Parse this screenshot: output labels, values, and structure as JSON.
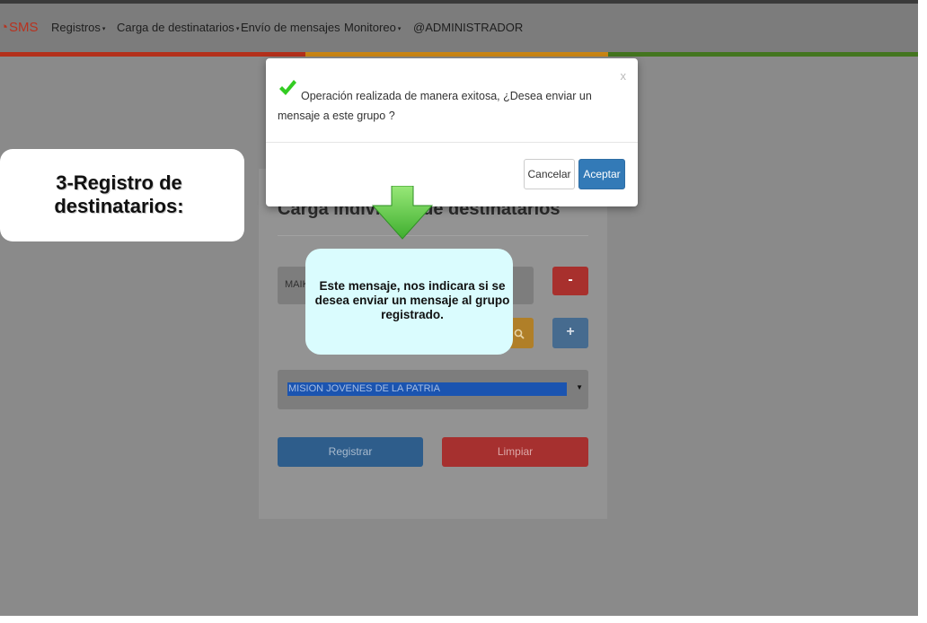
{
  "navbar": {
    "brand": "SMS",
    "items": [
      {
        "label": "Registros",
        "has_caret": true
      },
      {
        "label": "Carga de destinatarios",
        "has_caret": true
      },
      {
        "label": "Envío de mensajes",
        "has_caret": false
      },
      {
        "label": "Monitoreo",
        "has_caret": true
      },
      {
        "label": "@ADMINISTRADOR",
        "has_caret": false
      }
    ],
    "caret_glyph": "▾",
    "brand_icon": "sms-logo-icon"
  },
  "colors": {
    "bar_red": "#b3301b",
    "bar_orange": "#c98514",
    "bar_green": "#43751f",
    "accept_blue": "#337ab7",
    "check_green": "#33cc22",
    "callout_cyan": "#dafcfe"
  },
  "form": {
    "title": "Carga individual de destinatarios",
    "name_value": "MAIK",
    "minus_label": "-",
    "plus_label": "+",
    "search_icon": "search-icon",
    "group_selected": "MISION JOVENES DE LA PATRIA",
    "register_label": "Registrar",
    "clear_label": "Limpiar"
  },
  "modal": {
    "close_label": "x",
    "message": "Operación realizada de manera exitosa, ¿Desea enviar un mensaje a este grupo ?",
    "cancel_label": "Cancelar",
    "accept_label": "Aceptar",
    "icon": "check-icon"
  },
  "annotations": {
    "step_label": "3-Registro de destinatarios:",
    "explanation": "Este mensaje, nos indicara si se desea enviar un mensaje al grupo registrado.",
    "arrow_icon": "down-arrow-icon"
  }
}
